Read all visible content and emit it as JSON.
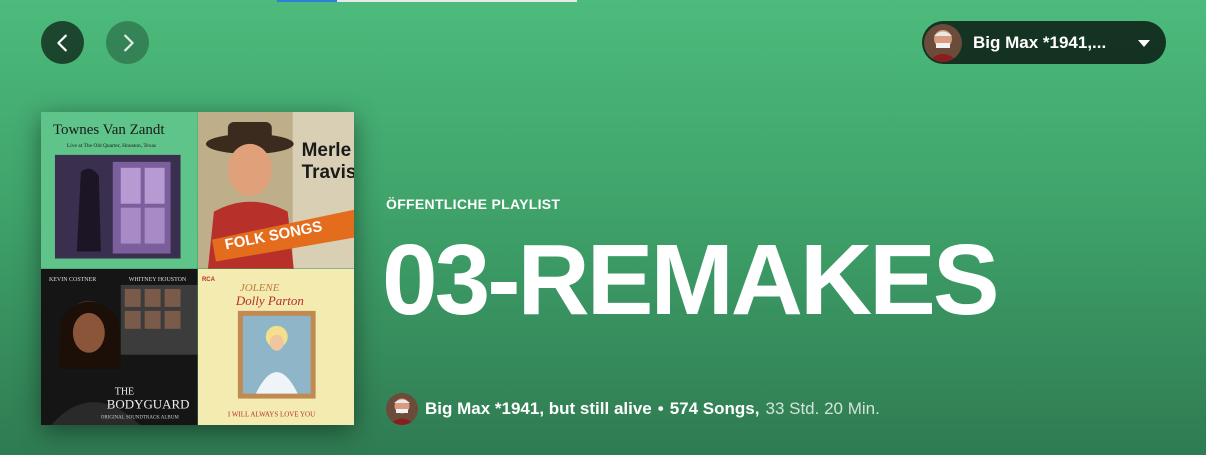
{
  "header": {
    "back_icon": "chevron-left-icon",
    "forward_icon": "chevron-right-icon",
    "user": {
      "name": "Big Max *1941,...",
      "dropdown_icon": "caret-down-icon"
    }
  },
  "playlist": {
    "type": "ÖFFENTLICHE PLAYLIST",
    "title": "03-REMAKES",
    "owner": "Big Max *1941, but still alive",
    "separator": "•",
    "songs": "574 Songs,",
    "duration": "33 Std. 20 Min."
  },
  "cover": {
    "tiles": [
      {
        "title": "Townes Van Zandt",
        "subtitle": "Live at The Old Quarter, Houston, Texas"
      },
      {
        "title": "Merle Travis",
        "subtitle": "FOLK SONGS OF THE HILLS"
      },
      {
        "title": "THE BODYGUARD",
        "subtitle": "KEVIN COSTNER  WHITNEY HOUSTON"
      },
      {
        "title": "JOLENE Dolly Parton",
        "subtitle": "I WILL ALWAYS LOVE YOU"
      }
    ]
  },
  "colors": {
    "background_top": "#4cbb7c",
    "background_bottom": "#2f7b52"
  }
}
